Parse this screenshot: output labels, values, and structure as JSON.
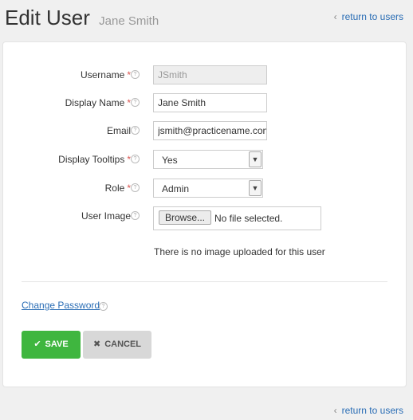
{
  "header": {
    "title": "Edit User",
    "subtitle": "Jane Smith",
    "return_label": "return to users",
    "return_chevron": "‹"
  },
  "form": {
    "required_mark": "*",
    "help_glyph": "?",
    "username": {
      "label": "Username",
      "value": "JSmith"
    },
    "display_name": {
      "label": "Display Name",
      "value": "Jane Smith"
    },
    "email": {
      "label": "Email",
      "value": "jsmith@practicename.com"
    },
    "display_tooltips": {
      "label": "Display Tooltips",
      "value": "Yes"
    },
    "role": {
      "label": "Role",
      "value": "Admin"
    },
    "user_image": {
      "label": "User Image",
      "browse_label": "Browse...",
      "file_status": "No file selected.",
      "no_image_text": "There is no image uploaded for this user"
    },
    "change_password_label": "Change Password"
  },
  "actions": {
    "save_label": "SAVE",
    "save_icon": "✔",
    "cancel_label": "CANCEL",
    "cancel_icon": "✖"
  },
  "colors": {
    "save": "#3fb63f",
    "cancel": "#d8d8d8",
    "link": "#2a6db5",
    "required": "#d9534f"
  }
}
